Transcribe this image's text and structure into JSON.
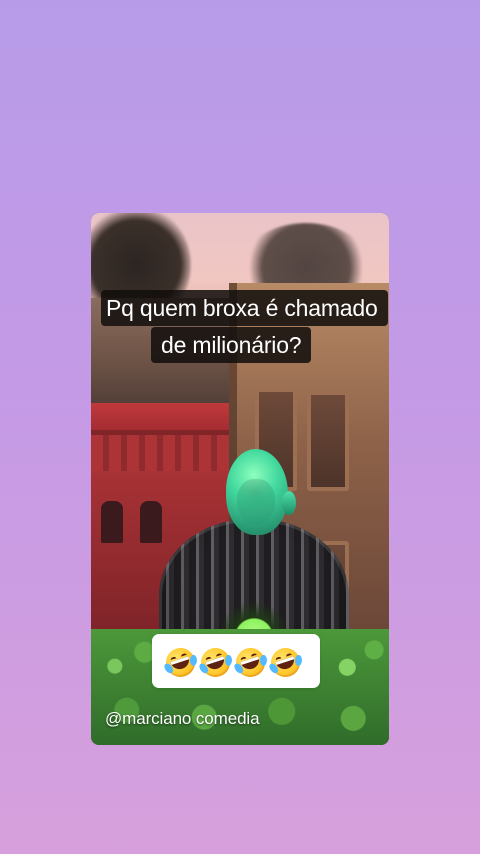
{
  "story": {
    "caption_lines": [
      "Pq  quem broxa é chamado",
      "de milionário?"
    ],
    "emoji_text": "🤣🤣🤣🤣",
    "emoji_icons": [
      "rolling-on-floor-laughing",
      "rolling-on-floor-laughing",
      "rolling-on-floor-laughing",
      "rolling-on-floor-laughing"
    ],
    "watermark": "@marciano comedia"
  },
  "colors": {
    "background_top": "#b79be9",
    "background_bottom": "#d7a0dc",
    "caption_background": "#120e0d",
    "caption_text": "#ffffff",
    "emoji_box": "#ffffff",
    "alien_skin": "#43d99e"
  }
}
